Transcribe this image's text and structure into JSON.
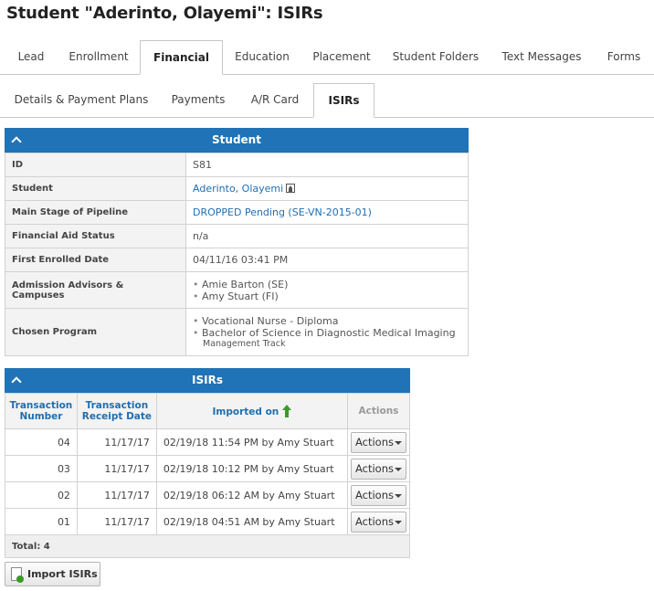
{
  "page": {
    "title": "Student \"Aderinto, Olayemi\": ISIRs"
  },
  "main_tabs": [
    {
      "label": "Lead"
    },
    {
      "label": "Enrollment"
    },
    {
      "label": "Financial"
    },
    {
      "label": "Education"
    },
    {
      "label": "Placement"
    },
    {
      "label": "Student Folders"
    },
    {
      "label": "Text Messages"
    },
    {
      "label": "Forms"
    }
  ],
  "sub_tabs": [
    {
      "label": "Details & Payment Plans"
    },
    {
      "label": "Payments"
    },
    {
      "label": "A/R Card"
    },
    {
      "label": "ISIRs"
    }
  ],
  "student_panel": {
    "title": "Student",
    "id_label": "ID",
    "id_value": "S81",
    "student_label": "Student",
    "student_value": "Aderinto, Olayemi",
    "stage_label": "Main Stage of Pipeline",
    "stage_value": "DROPPED Pending (SE-VN-2015-01)",
    "aid_label": "Financial Aid Status",
    "aid_value": "n/a",
    "enrolled_label": "First Enrolled Date",
    "enrolled_value": "04/11/16 03:41 PM",
    "advisors_label": "Admission Advisors & Campuses",
    "advisors": [
      "Amie Barton (SE)",
      "Amy Stuart (FI)"
    ],
    "program_label": "Chosen Program",
    "programs": [
      "Vocational Nurse - Diploma",
      "Bachelor of Science in Diagnostic Medical Imaging"
    ],
    "program_track": "Management Track"
  },
  "isirs_panel": {
    "title": "ISIRs",
    "col_txn_number": "Transaction Number",
    "col_receipt_date": "Transaction Receipt Date",
    "col_imported_on": "Imported on",
    "col_actions": "Actions",
    "rows": [
      {
        "number": "04",
        "date": "11/17/17",
        "imported": "02/19/18 11:54 PM by Amy Stuart",
        "action": "Actions"
      },
      {
        "number": "03",
        "date": "11/17/17",
        "imported": "02/19/18 10:12 PM by Amy Stuart",
        "action": "Actions"
      },
      {
        "number": "02",
        "date": "11/17/17",
        "imported": "02/19/18 06:12 AM by Amy Stuart",
        "action": "Actions"
      },
      {
        "number": "01",
        "date": "11/17/17",
        "imported": "02/19/18 04:51 AM by Amy Stuart",
        "action": "Actions"
      }
    ],
    "total": "Total: 4"
  },
  "import_button": "Import ISIRs",
  "colors": {
    "accent": "#1f73b6",
    "link": "#1f6fb2",
    "sort_arrow": "#3a9a2a"
  }
}
